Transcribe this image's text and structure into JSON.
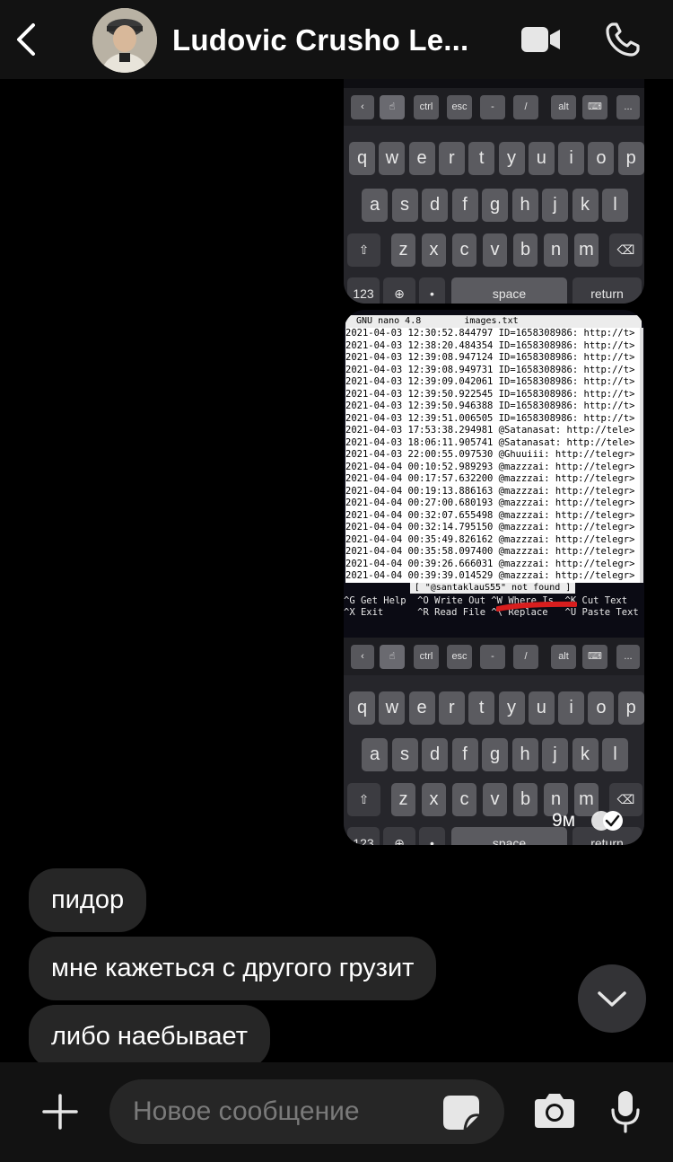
{
  "header": {
    "title": "Ludovic Crusho Le...",
    "back_icon": "chevron-left-icon",
    "video_icon": "video-camera-icon",
    "call_icon": "phone-icon"
  },
  "keyboard": {
    "toolbar": [
      "ctrl",
      "esc",
      "-",
      "/",
      "alt",
      "..."
    ],
    "row1": [
      "q",
      "w",
      "e",
      "r",
      "t",
      "y",
      "u",
      "i",
      "o",
      "p"
    ],
    "row2": [
      "a",
      "s",
      "d",
      "f",
      "g",
      "h",
      "j",
      "k",
      "l"
    ],
    "row3": [
      "z",
      "x",
      "c",
      "v",
      "b",
      "n",
      "m"
    ],
    "num_key": "123",
    "space_key": "space",
    "return_key": "return"
  },
  "terminal": {
    "header": "GNU nano 4.8        images.txt",
    "lines": [
      "2021-04-03 12:30:52.844797 ID=1658308986: http://t>",
      "2021-04-03 12:38:20.484354 ID=1658308986: http://t>",
      "2021-04-03 12:39:08.947124 ID=1658308986: http://t>",
      "2021-04-03 12:39:08.949731 ID=1658308986: http://t>",
      "2021-04-03 12:39:09.042061 ID=1658308986: http://t>",
      "2021-04-03 12:39:50.922545 ID=1658308986: http://t>",
      "2021-04-03 12:39:50.946388 ID=1658308986: http://t>",
      "2021-04-03 12:39:51.006505 ID=1658308986: http://t>",
      "2021-04-03 17:53:38.294981 @Satanasat: http://tele>",
      "2021-04-03 18:06:11.905741 @Satanasat: http://tele>",
      "2021-04-03 22:00:55.097530 @Ghuuiii: http://telegr>",
      "2021-04-04 00:10:52.989293 @mazzzai: http://telegr>",
      "2021-04-04 00:17:57.632200 @mazzzai: http://telegr>",
      "2021-04-04 00:19:13.886163 @mazzzai: http://telegr>",
      "2021-04-04 00:27:00.680193 @mazzzai: http://telegr>",
      "2021-04-04 00:32:07.655498 @mazzzai: http://telegr>",
      "2021-04-04 00:32:14.795150 @mazzzai: http://telegr>",
      "2021-04-04 00:35:49.826162 @mazzzai: http://telegr>",
      "2021-04-04 00:35:58.097400 @mazzzai: http://telegr>",
      "2021-04-04 00:39:26.666031 @mazzzai: http://telegr>",
      "2021-04-04 00:39:39.014529 @mazzzai: http://telegr>"
    ],
    "status": "[ \"@santaklauS55\" not found ]",
    "help_line1": "^G Get Help  ^O Write Out ^W Where Is  ^K Cut Text",
    "help_line2": "^X Exit      ^R Read File ^\\ Replace   ^U Paste Text"
  },
  "sent_message": {
    "timestamp": "9м",
    "status_icon": "double-check-icon"
  },
  "incoming_messages": [
    "пидор",
    "мне кажеться с другого грузит",
    "либо наебывает"
  ],
  "scroll_icon": "chevron-down-icon",
  "composer": {
    "placeholder": "Новое сообщение",
    "attach_icon": "plus-icon",
    "sticker_icon": "sticker-icon",
    "camera_icon": "camera-icon",
    "mic_icon": "microphone-icon"
  },
  "colors": {
    "background": "#000000",
    "bubble": "#262626",
    "bar": "#121212"
  }
}
